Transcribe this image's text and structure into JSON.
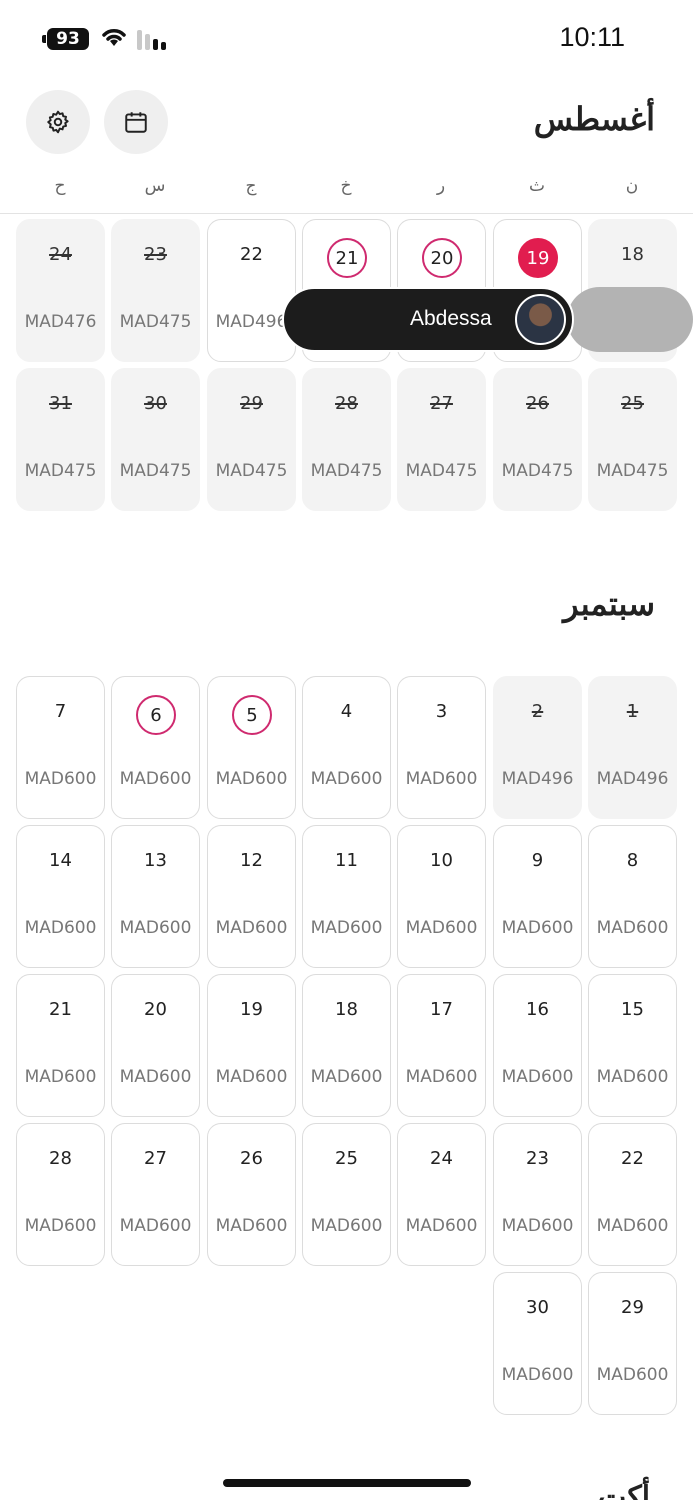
{
  "status_bar": {
    "battery": "93",
    "time": "10:11"
  },
  "header": {
    "settings_icon": "gear-icon",
    "calendar_icon": "calendar-icon"
  },
  "weekdays": [
    "ح",
    "س",
    "ج",
    "خ",
    "ر",
    "ث",
    "ن"
  ],
  "months": [
    {
      "title": "أغسطس"
    },
    {
      "title": "سبتمبر"
    }
  ],
  "next_month_title_partial": "أكت",
  "host_pill": {
    "name": "Abdessa",
    "avatar": "host-avatar"
  },
  "accent_color": "#e11d4f",
  "august": {
    "row1": [
      {
        "day": "24",
        "price": "MAD476",
        "state": "disabled"
      },
      {
        "day": "23",
        "price": "MAD475",
        "state": "disabled"
      },
      {
        "day": "22",
        "price": "MAD496",
        "state": "available"
      },
      {
        "day": "21",
        "price": "",
        "state": "ringed"
      },
      {
        "day": "20",
        "price": "",
        "state": "ringed"
      },
      {
        "day": "19",
        "price": "",
        "state": "selected"
      },
      {
        "day": "18",
        "price": "",
        "state": "disabled"
      }
    ],
    "row2": [
      {
        "day": "31",
        "price": "MAD475",
        "state": "disabled"
      },
      {
        "day": "30",
        "price": "MAD475",
        "state": "disabled"
      },
      {
        "day": "29",
        "price": "MAD475",
        "state": "disabled"
      },
      {
        "day": "28",
        "price": "MAD475",
        "state": "disabled"
      },
      {
        "day": "27",
        "price": "MAD475",
        "state": "disabled"
      },
      {
        "day": "26",
        "price": "MAD475",
        "state": "disabled"
      },
      {
        "day": "25",
        "price": "MAD475",
        "state": "disabled"
      }
    ]
  },
  "september": {
    "row1": [
      {
        "day": "7",
        "price": "MAD600",
        "state": "available"
      },
      {
        "day": "6",
        "price": "MAD600",
        "state": "ringed"
      },
      {
        "day": "5",
        "price": "MAD600",
        "state": "ringed"
      },
      {
        "day": "4",
        "price": "MAD600",
        "state": "available"
      },
      {
        "day": "3",
        "price": "MAD600",
        "state": "available"
      },
      {
        "day": "2",
        "price": "MAD496",
        "state": "disabled"
      },
      {
        "day": "1",
        "price": "MAD496",
        "state": "disabled"
      }
    ],
    "row2": [
      {
        "day": "14",
        "price": "MAD600"
      },
      {
        "day": "13",
        "price": "MAD600"
      },
      {
        "day": "12",
        "price": "MAD600"
      },
      {
        "day": "11",
        "price": "MAD600"
      },
      {
        "day": "10",
        "price": "MAD600"
      },
      {
        "day": "9",
        "price": "MAD600"
      },
      {
        "day": "8",
        "price": "MAD600"
      }
    ],
    "row3": [
      {
        "day": "21",
        "price": "MAD600"
      },
      {
        "day": "20",
        "price": "MAD600"
      },
      {
        "day": "19",
        "price": "MAD600"
      },
      {
        "day": "18",
        "price": "MAD600"
      },
      {
        "day": "17",
        "price": "MAD600"
      },
      {
        "day": "16",
        "price": "MAD600"
      },
      {
        "day": "15",
        "price": "MAD600"
      }
    ],
    "row4": [
      {
        "day": "28",
        "price": "MAD600"
      },
      {
        "day": "27",
        "price": "MAD600"
      },
      {
        "day": "26",
        "price": "MAD600"
      },
      {
        "day": "25",
        "price": "MAD600"
      },
      {
        "day": "24",
        "price": "MAD600"
      },
      {
        "day": "23",
        "price": "MAD600"
      },
      {
        "day": "22",
        "price": "MAD600"
      }
    ],
    "row5": [
      {
        "day": "30",
        "price": "MAD600"
      },
      {
        "day": "29",
        "price": "MAD600"
      }
    ]
  }
}
